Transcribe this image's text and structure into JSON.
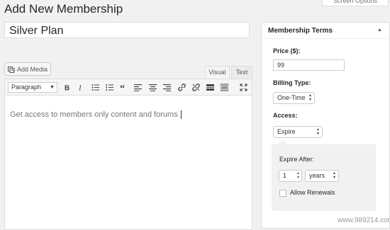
{
  "page": {
    "title": "Add New Membership",
    "screen_options_label": "Screen Options"
  },
  "post": {
    "title_value": "Silver Plan"
  },
  "editor": {
    "add_media_label": "Add Media",
    "tabs": [
      {
        "label": "Visual",
        "active": true
      },
      {
        "label": "Text",
        "active": false
      }
    ],
    "toolbar": {
      "format_value": "Paragraph",
      "buttons": [
        "bold-icon",
        "italic-icon",
        "bullet-list-icon",
        "numbered-list-icon",
        "blockquote-icon",
        "align-left-icon",
        "align-center-icon",
        "align-right-icon",
        "link-icon",
        "unlink-icon",
        "read-more-icon",
        "toolbar-toggle-icon",
        "fullscreen-icon"
      ]
    },
    "content": "Get access to members only content and forums."
  },
  "membership_terms": {
    "title": "Membership Terms",
    "price_label": "Price ($):",
    "price_value": "99",
    "billing_type_label": "Billing Type:",
    "billing_type_value": "One-Time",
    "access_label": "Access:",
    "access_value": "Expire",
    "expire_after_label": "Expire After:",
    "expire_after_value": "1",
    "expire_unit_value": "years",
    "allow_renewals_label": "Allow Renewals",
    "allow_renewals_checked": false
  },
  "watermark": "www.989214.com",
  "colors": {
    "background": "#f1f1f1",
    "panel": "#ffffff",
    "border": "#dddddd",
    "text": "#23282d"
  }
}
